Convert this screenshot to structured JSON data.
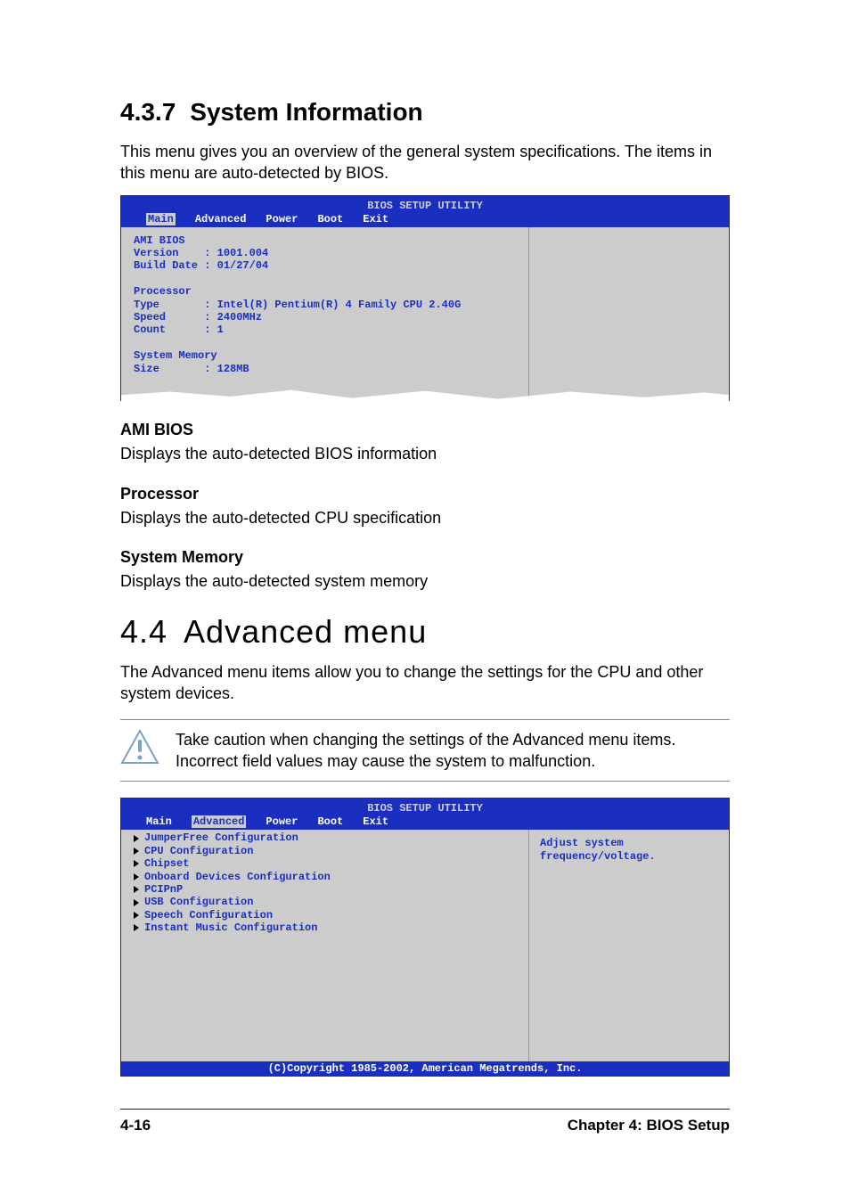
{
  "section437": {
    "number": "4.3.7",
    "title": "System Information",
    "intro": "This menu gives you an overview of the general system specifications. The items in this menu are auto-detected by BIOS."
  },
  "bios1": {
    "title": "BIOS SETUP UTILITY",
    "tabs": [
      "Main",
      "Advanced",
      "Power",
      "Boot",
      "Exit"
    ],
    "selected_tab_index": 0,
    "ami": {
      "heading": "AMI BIOS",
      "version_label": "Version",
      "version_value": "1001.004",
      "build_label": "Build Date",
      "build_value": "01/27/04"
    },
    "processor": {
      "heading": "Processor",
      "type_label": "Type",
      "type_value": "Intel(R) Pentium(R) 4 Family CPU 2.40G",
      "speed_label": "Speed",
      "speed_value": "2400MHz",
      "count_label": "Count",
      "count_value": "1"
    },
    "memory": {
      "heading": "System Memory",
      "size_label": "Size",
      "size_value": "128MB"
    }
  },
  "sub1": {
    "title": "AMI BIOS",
    "desc": "Displays the auto-detected BIOS information"
  },
  "sub2": {
    "title": "Processor",
    "desc": "Displays the auto-detected CPU specification"
  },
  "sub3": {
    "title": "System Memory",
    "desc": "Displays the auto-detected system memory"
  },
  "section44": {
    "number": "4.4",
    "title": "Advanced menu",
    "body": "The Advanced menu items allow you to change the settings for the CPU and other system devices.",
    "caution": "Take caution when changing the settings of the Advanced menu items. Incorrect field values may cause the system to malfunction."
  },
  "bios2": {
    "title": "BIOS SETUP UTILITY",
    "tabs": [
      "Main",
      "Advanced",
      "Power",
      "Boot",
      "Exit"
    ],
    "selected_tab_index": 1,
    "items": [
      "JumperFree Configuration",
      "CPU Configuration",
      "Chipset",
      "Onboard Devices Configuration",
      "PCIPnP",
      "USB Configuration",
      "Speech Configuration",
      "Instant Music Configuration"
    ],
    "help1": "Adjust system",
    "help2": "frequency/voltage.",
    "footer": "(C)Copyright 1985-2002, American Megatrends, Inc."
  },
  "footer": {
    "left": "4-16",
    "right": "Chapter 4: BIOS Setup"
  }
}
